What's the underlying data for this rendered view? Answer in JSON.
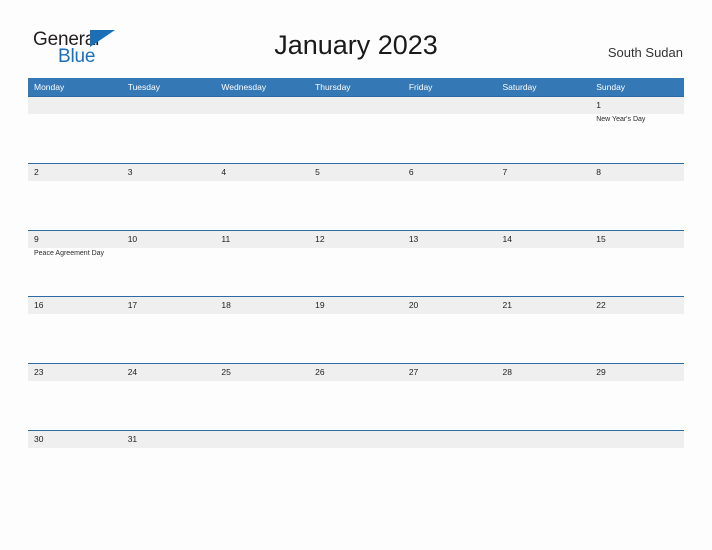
{
  "brand": {
    "name_part1": "General",
    "name_part2": "Blue",
    "triangle_icon": "triangle-icon",
    "colors": {
      "blue": "#1c6fb4",
      "dark": "#231f20"
    }
  },
  "header": {
    "title": "January 2023",
    "country": "South Sudan"
  },
  "theme": {
    "header_blue": "#3478b5",
    "border_blue": "#2d6ca2",
    "band_gray": "#efefef",
    "page_background": "#fdfdfd"
  },
  "calendar": {
    "month": "January",
    "year": "2023",
    "weekdays": [
      "Monday",
      "Tuesday",
      "Wednesday",
      "Thursday",
      "Friday",
      "Saturday",
      "Sunday"
    ],
    "weeks": [
      [
        {
          "date": "",
          "event": ""
        },
        {
          "date": "",
          "event": ""
        },
        {
          "date": "",
          "event": ""
        },
        {
          "date": "",
          "event": ""
        },
        {
          "date": "",
          "event": ""
        },
        {
          "date": "",
          "event": ""
        },
        {
          "date": "1",
          "event": "New Year's Day"
        }
      ],
      [
        {
          "date": "2",
          "event": ""
        },
        {
          "date": "3",
          "event": ""
        },
        {
          "date": "4",
          "event": ""
        },
        {
          "date": "5",
          "event": ""
        },
        {
          "date": "6",
          "event": ""
        },
        {
          "date": "7",
          "event": ""
        },
        {
          "date": "8",
          "event": ""
        }
      ],
      [
        {
          "date": "9",
          "event": "Peace Agreement Day"
        },
        {
          "date": "10",
          "event": ""
        },
        {
          "date": "11",
          "event": ""
        },
        {
          "date": "12",
          "event": ""
        },
        {
          "date": "13",
          "event": ""
        },
        {
          "date": "14",
          "event": ""
        },
        {
          "date": "15",
          "event": ""
        }
      ],
      [
        {
          "date": "16",
          "event": ""
        },
        {
          "date": "17",
          "event": ""
        },
        {
          "date": "18",
          "event": ""
        },
        {
          "date": "19",
          "event": ""
        },
        {
          "date": "20",
          "event": ""
        },
        {
          "date": "21",
          "event": ""
        },
        {
          "date": "22",
          "event": ""
        }
      ],
      [
        {
          "date": "23",
          "event": ""
        },
        {
          "date": "24",
          "event": ""
        },
        {
          "date": "25",
          "event": ""
        },
        {
          "date": "26",
          "event": ""
        },
        {
          "date": "27",
          "event": ""
        },
        {
          "date": "28",
          "event": ""
        },
        {
          "date": "29",
          "event": ""
        }
      ],
      [
        {
          "date": "30",
          "event": ""
        },
        {
          "date": "31",
          "event": ""
        },
        {
          "date": "",
          "event": ""
        },
        {
          "date": "",
          "event": ""
        },
        {
          "date": "",
          "event": ""
        },
        {
          "date": "",
          "event": ""
        },
        {
          "date": "",
          "event": ""
        }
      ]
    ]
  }
}
